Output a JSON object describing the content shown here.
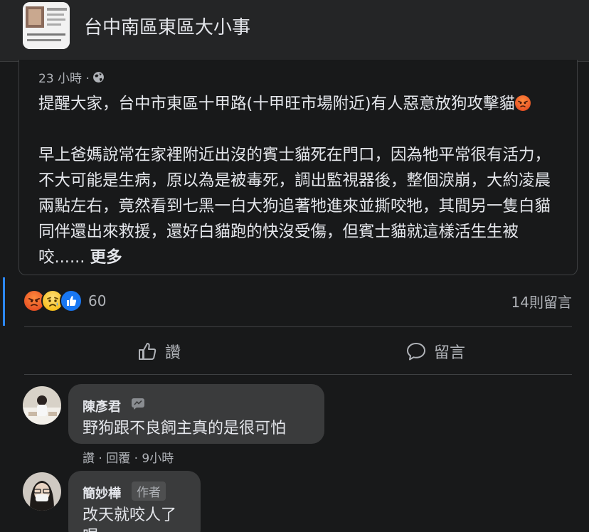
{
  "header": {
    "title": "台中南區東區大小事"
  },
  "post": {
    "time": "23 小時 ·",
    "para1": "提醒大家，台中市東區十甲路(十甲旺市場附近)有人惡意放狗攻擊貓",
    "para2": "早上爸媽說常在家裡附近出沒的賓士貓死在門口，因為牠平常很有活力，不大可能是生病，原以為是被毒死，調出監視器後，整個淚崩，大約凌晨兩點左右，竟然看到七黑一白大狗追著牠進來並撕咬牠，其間另一隻白貓同伴還出來救援，還好白貓跑的快沒受傷，但賓士貓就這樣活生生被咬......",
    "more_label": "更多"
  },
  "reactions": {
    "count": "60",
    "comments_count": "14則留言"
  },
  "actions": {
    "like_label": "讚",
    "comment_label": "留言"
  },
  "comments": [
    {
      "name": "陳彥君",
      "text": "野狗跟不良飼主真的是很可怕",
      "actions": "讚 · 回覆 · 9小時"
    },
    {
      "name": "簡妙樺",
      "badge": "作者",
      "text_line1": "改天就咬人了",
      "text_line2": "喔"
    }
  ],
  "colors": {
    "background": "#18191a",
    "surface": "#242526",
    "bubble": "#3a3b3c",
    "accent": "#2d88ff",
    "text": "#e4e6eb",
    "muted": "#b0b3b8"
  }
}
